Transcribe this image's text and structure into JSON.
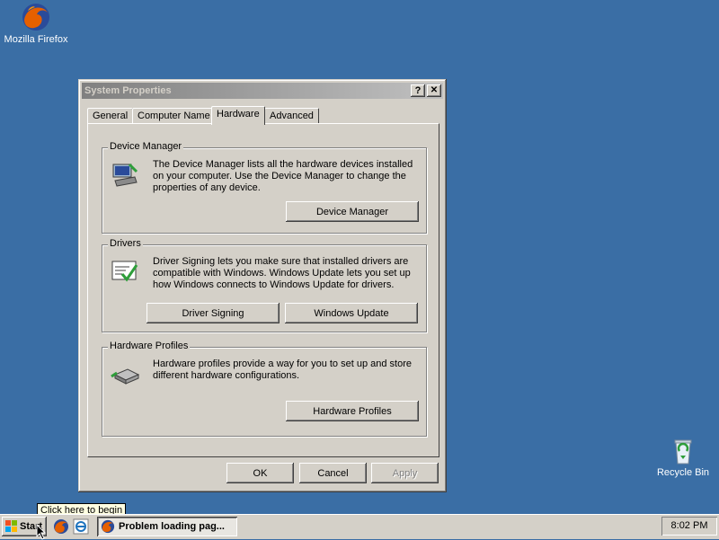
{
  "desktop": {
    "icons": [
      {
        "name": "firefox",
        "label": "Mozilla Firefox"
      },
      {
        "name": "recycle-bin",
        "label": "Recycle Bin"
      }
    ]
  },
  "dialog": {
    "title": "System Properties",
    "help_btn": "?",
    "close_btn": "✕",
    "tabs": [
      "General",
      "Computer Name",
      "Hardware",
      "Advanced"
    ],
    "active_tab": "Hardware",
    "groups": {
      "device_manager": {
        "title": "Device Manager",
        "text": "The Device Manager lists all the hardware devices installed on your computer. Use the Device Manager to change the properties of any device.",
        "button": "Device Manager"
      },
      "drivers": {
        "title": "Drivers",
        "text": "Driver Signing lets you make sure that installed drivers are compatible with Windows. Windows Update lets you set up how Windows connects to Windows Update for drivers.",
        "button_signing": "Driver Signing",
        "button_update": "Windows Update"
      },
      "hardware_profiles": {
        "title": "Hardware Profiles",
        "text": "Hardware profiles provide a way for you to set up and store different hardware configurations.",
        "button": "Hardware Profiles"
      }
    },
    "ok": "OK",
    "cancel": "Cancel",
    "apply": "Apply"
  },
  "taskbar": {
    "start_label": "Start",
    "tooltip": "Click here to begin",
    "task_label": "Problem loading pag...",
    "clock": "8:02 PM"
  },
  "colors": {
    "desktop": "#3A6EA5",
    "face": "#D4D0C8",
    "title_inactive": "#808080"
  }
}
